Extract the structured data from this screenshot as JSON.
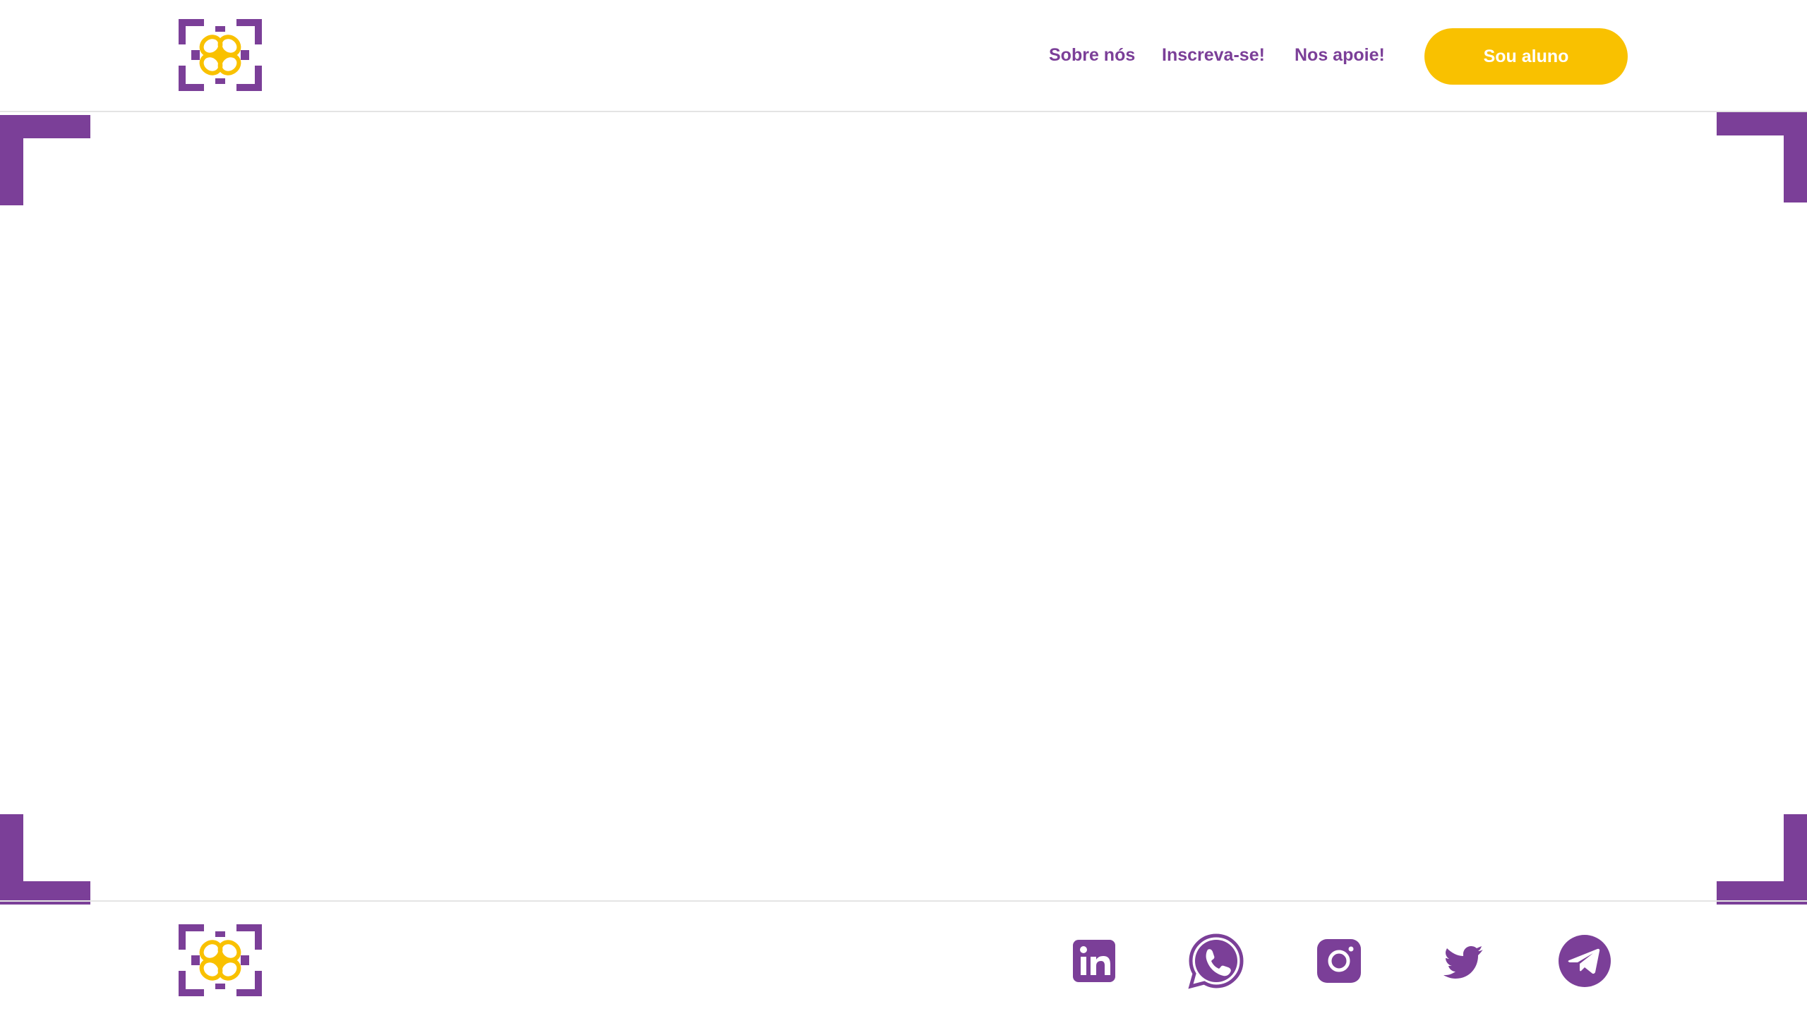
{
  "brand": {
    "logo_icon": "butterfly-frame-logo",
    "primary_color": "#7b3f98",
    "accent_color": "#f9c100"
  },
  "header": {
    "nav": {
      "sobre": "Sobre nós",
      "inscreva": "Inscreva-se!",
      "apoie": "Nos apoie!"
    },
    "cta_label": "Sou aluno"
  },
  "footer": {
    "social_icons": [
      "linkedin-icon",
      "whatsapp-icon",
      "instagram-icon",
      "twitter-icon",
      "telegram-icon"
    ]
  }
}
